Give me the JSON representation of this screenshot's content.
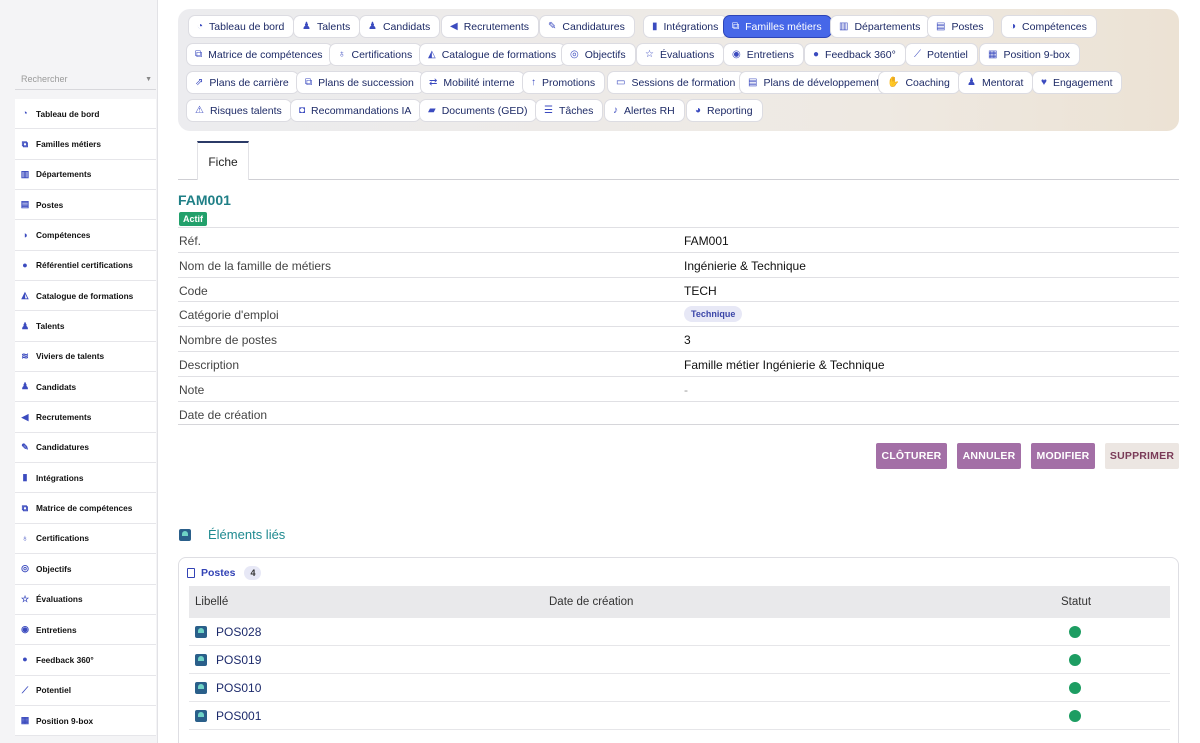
{
  "sidebar": {
    "search_placeholder": "Rechercher",
    "items": [
      {
        "label": "Tableau de bord",
        "icon": "dashboard-icon",
        "glyph": "◔"
      },
      {
        "label": "Familles métiers",
        "icon": "sitemap-icon",
        "glyph": "⧉"
      },
      {
        "label": "Départements",
        "icon": "building-icon",
        "glyph": "▥"
      },
      {
        "label": "Postes",
        "icon": "id-badge-icon",
        "glyph": "▤"
      },
      {
        "label": "Compétences",
        "icon": "brain-icon",
        "glyph": "◑"
      },
      {
        "label": "Référentiel certifications",
        "icon": "certificate-icon",
        "glyph": "●"
      },
      {
        "label": "Catalogue de formations",
        "icon": "graduation-cap-icon",
        "glyph": "◭"
      },
      {
        "label": "Talents",
        "icon": "user-icon",
        "glyph": "♟"
      },
      {
        "label": "Viviers de talents",
        "icon": "layers-icon",
        "glyph": "≋"
      },
      {
        "label": "Candidats",
        "icon": "user-plus-icon",
        "glyph": "♟"
      },
      {
        "label": "Recrutements",
        "icon": "megaphone-icon",
        "glyph": "◀"
      },
      {
        "label": "Candidatures",
        "icon": "file-signature-icon",
        "glyph": "✎"
      },
      {
        "label": "Intégrations",
        "icon": "door-open-icon",
        "glyph": "▮"
      },
      {
        "label": "Matrice de compétences",
        "icon": "matrix-icon",
        "glyph": "⧉"
      },
      {
        "label": "Certifications",
        "icon": "award-icon",
        "glyph": "♁"
      },
      {
        "label": "Objectifs",
        "icon": "target-icon",
        "glyph": "◎"
      },
      {
        "label": "Évaluations",
        "icon": "star-half-icon",
        "glyph": "☆"
      },
      {
        "label": "Entretiens",
        "icon": "comments-icon",
        "glyph": "◉"
      },
      {
        "label": "Feedback 360°",
        "icon": "comment-dots-icon",
        "glyph": "●"
      },
      {
        "label": "Potentiel",
        "icon": "chart-line-icon",
        "glyph": "⟋"
      },
      {
        "label": "Position 9-box",
        "icon": "grid-icon",
        "glyph": "▦"
      }
    ]
  },
  "topnav": [
    {
      "label": "Tableau de bord",
      "icon": "dashboard-icon",
      "glyph": "◔",
      "active": false
    },
    {
      "label": "Talents",
      "icon": "user-icon",
      "glyph": "♟",
      "active": false
    },
    {
      "label": "Candidats",
      "icon": "user-plus-icon",
      "glyph": "♟",
      "active": false
    },
    {
      "label": "Recrutements",
      "icon": "megaphone-icon",
      "glyph": "◀",
      "active": false
    },
    {
      "label": "Candidatures",
      "icon": "file-signature-icon",
      "glyph": "✎",
      "active": false
    },
    {
      "label": "Intégrations",
      "icon": "door-open-icon",
      "glyph": "▮",
      "active": false
    },
    {
      "label": "Familles métiers",
      "icon": "sitemap-icon",
      "glyph": "⧉",
      "active": true
    },
    {
      "label": "Départements",
      "icon": "building-icon",
      "glyph": "▥",
      "active": false
    },
    {
      "label": "Postes",
      "icon": "id-badge-icon",
      "glyph": "▤",
      "active": false
    },
    {
      "label": "Compétences",
      "icon": "brain-icon",
      "glyph": "◑",
      "active": false
    },
    {
      "label": "Matrice de compétences",
      "icon": "matrix-icon",
      "glyph": "⧉",
      "active": false
    },
    {
      "label": "Certifications",
      "icon": "award-icon",
      "glyph": "♁",
      "active": false
    },
    {
      "label": "Catalogue de formations",
      "icon": "graduation-cap-icon",
      "glyph": "◭",
      "active": false
    },
    {
      "label": "Objectifs",
      "icon": "target-icon",
      "glyph": "◎",
      "active": false
    },
    {
      "label": "Évaluations",
      "icon": "star-half-icon",
      "glyph": "☆",
      "active": false
    },
    {
      "label": "Entretiens",
      "icon": "comments-icon",
      "glyph": "◉",
      "active": false
    },
    {
      "label": "Feedback 360°",
      "icon": "comment-dots-icon",
      "glyph": "●",
      "active": false
    },
    {
      "label": "Potentiel",
      "icon": "chart-line-icon",
      "glyph": "⟋",
      "active": false
    },
    {
      "label": "Position 9-box",
      "icon": "grid-icon",
      "glyph": "▦",
      "active": false
    },
    {
      "label": "Plans de carrière",
      "icon": "road-icon",
      "glyph": "⇗",
      "active": false
    },
    {
      "label": "Plans de succession",
      "icon": "sitemap-icon",
      "glyph": "⧉",
      "active": false
    },
    {
      "label": "Mobilité interne",
      "icon": "exchange-icon",
      "glyph": "⇄",
      "active": false
    },
    {
      "label": "Promotions",
      "icon": "arrow-up-icon",
      "glyph": "↑",
      "active": false
    },
    {
      "label": "Sessions de formation",
      "icon": "chalkboard-icon",
      "glyph": "▭",
      "active": false
    },
    {
      "label": "Plans de développement",
      "icon": "clipboard-icon",
      "glyph": "▤",
      "active": false
    },
    {
      "label": "Coaching",
      "icon": "handshake-icon",
      "glyph": "✋",
      "active": false
    },
    {
      "label": "Mentorat",
      "icon": "user-tie-icon",
      "glyph": "♟",
      "active": false
    },
    {
      "label": "Engagement",
      "icon": "heart-icon",
      "glyph": "♥",
      "active": false
    },
    {
      "label": "Risques talents",
      "icon": "warning-icon",
      "glyph": "⚠",
      "active": false
    },
    {
      "label": "Recommandations IA",
      "icon": "robot-icon",
      "glyph": "◘",
      "active": false
    },
    {
      "label": "Documents (GED)",
      "icon": "folder-open-icon",
      "glyph": "▰",
      "active": false
    },
    {
      "label": "Tâches",
      "icon": "tasks-icon",
      "glyph": "☰",
      "active": false
    },
    {
      "label": "Alertes RH",
      "icon": "bell-icon",
      "glyph": "♪",
      "active": false
    },
    {
      "label": "Reporting",
      "icon": "chart-pie-icon",
      "glyph": "◕",
      "active": false
    }
  ],
  "tab": {
    "label": "Fiche"
  },
  "record": {
    "title": "FAM001",
    "status": "Actif",
    "fields": [
      {
        "label": "Réf.",
        "value": "FAM001"
      },
      {
        "label": "Nom de la famille de métiers",
        "value": "Ingénierie & Technique"
      },
      {
        "label": "Code",
        "value": "TECH"
      },
      {
        "label": "Catégorie d'emploi",
        "chip": "Technique"
      },
      {
        "label": "Nombre de postes",
        "value": "3"
      },
      {
        "label": "Description",
        "value": "Famille métier Ingénierie & Technique"
      },
      {
        "label": "Note",
        "value": "-"
      },
      {
        "label": "Date de création",
        "value": ""
      }
    ]
  },
  "actions": {
    "close": "CLÔTURER",
    "cancel": "ANNULER",
    "edit": "MODIFIER",
    "delete": "SUPPRIMER"
  },
  "linked": {
    "title": "Éléments liés",
    "section": "Postes",
    "count": "4",
    "headers": {
      "label": "Libellé",
      "date": "Date de création",
      "status": "Statut"
    },
    "rows": [
      {
        "label": "POS028",
        "date": ""
      },
      {
        "label": "POS019",
        "date": ""
      },
      {
        "label": "POS010",
        "date": ""
      },
      {
        "label": "POS001",
        "date": ""
      }
    ]
  },
  "colors": {
    "accent": "#4667e8",
    "title_teal": "#1f7f86",
    "status_green": "#22a06b",
    "button_purple": "#a36fa6"
  }
}
